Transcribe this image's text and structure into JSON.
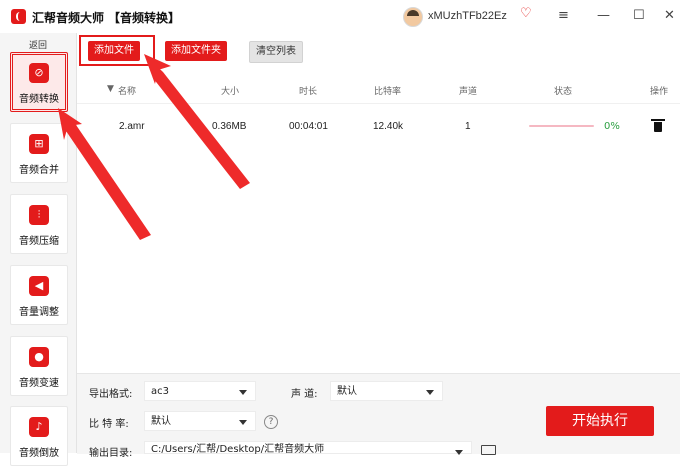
{
  "app": {
    "name": "汇帮音频大师",
    "window_title": "【音频转换】"
  },
  "user": {
    "name": "xMUzhTFb22Ez",
    "vip_icon": "heart-vip-icon"
  },
  "window_controls": {
    "menu": "≡",
    "minimize": "—",
    "maximize": "☐",
    "close": "✕"
  },
  "sidebar": {
    "back_label": "返回",
    "items": [
      {
        "label": "音频转换",
        "icon": "audio-convert-icon"
      },
      {
        "label": "音频合并",
        "icon": "audio-merge-icon"
      },
      {
        "label": "音频压缩",
        "icon": "audio-compress-icon"
      },
      {
        "label": "音量调整",
        "icon": "volume-icon"
      },
      {
        "label": "音频变速",
        "icon": "speed-icon"
      },
      {
        "label": "音频倒放",
        "icon": "reverse-icon"
      }
    ]
  },
  "toolbar": {
    "add_file": "添加文件",
    "add_folder": "添加文件夹",
    "clear_list": "清空列表"
  },
  "table": {
    "columns": [
      "名称",
      "大小",
      "时长",
      "比特率",
      "声道",
      "状态",
      "操作"
    ],
    "rows": [
      {
        "name": "2.amr",
        "size": "0.36MB",
        "duration": "00:04:01",
        "bitrate": "12.40k",
        "channels": "1",
        "progress_pct": 0,
        "progress_label": "0%"
      }
    ]
  },
  "settings": {
    "format_label": "导出格式:",
    "format_value": "ac3",
    "channel_label": "声 道:",
    "channel_value": "默认",
    "bitrate_label": "比 特 率:",
    "bitrate_value": "默认",
    "output_label": "输出目录:",
    "output_value": "C:/Users/汇帮/Desktop/汇帮音频大师"
  },
  "start_button": "开始执行",
  "colors": {
    "accent": "#e31b1b",
    "progress": "#e8466a",
    "status_ok": "#2ea043"
  }
}
